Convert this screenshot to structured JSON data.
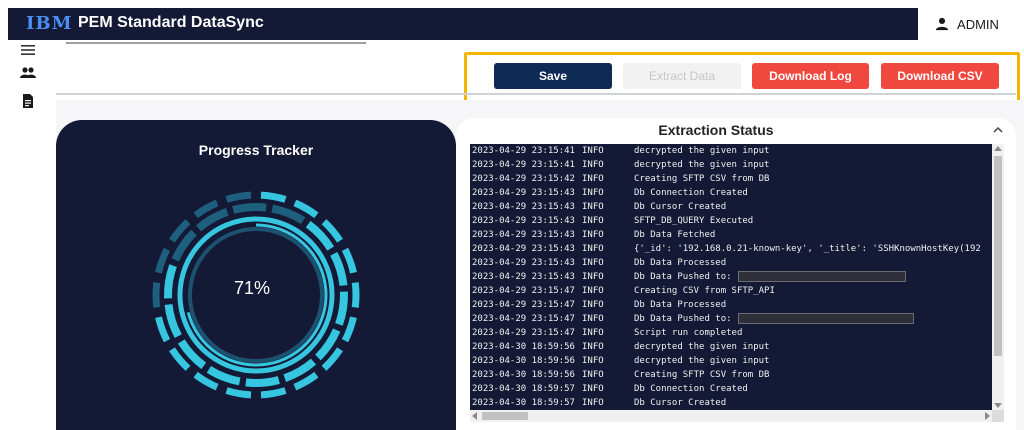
{
  "header": {
    "logo_text": "IBM",
    "title": "PEM Standard DataSync",
    "user_label": "ADMIN",
    "user_icon": "person-icon"
  },
  "sidebar": {
    "items": [
      {
        "icon": "menu-icon"
      },
      {
        "icon": "people-icon"
      },
      {
        "icon": "document-icon"
      }
    ]
  },
  "toolbar": {
    "save_label": "Save",
    "extract_label": "Extract Data",
    "extract_disabled": true,
    "download_log_label": "Download Log",
    "download_csv_label": "Download CSV"
  },
  "progress": {
    "title": "Progress Tracker",
    "value_text": "71%",
    "value": 71
  },
  "extraction": {
    "title": "Extraction Status",
    "logs": [
      {
        "ts": "2023-04-29 23:15:41",
        "level": "INFO",
        "msg": "decrypted the given input"
      },
      {
        "ts": "2023-04-29 23:15:41",
        "level": "INFO",
        "msg": "decrypted the given input"
      },
      {
        "ts": "2023-04-29 23:15:42",
        "level": "INFO",
        "msg": "Creating SFTP CSV from DB"
      },
      {
        "ts": "2023-04-29 23:15:43",
        "level": "INFO",
        "msg": "Db Connection Created"
      },
      {
        "ts": "2023-04-29 23:15:43",
        "level": "INFO",
        "msg": "Db Cursor Created"
      },
      {
        "ts": "2023-04-29 23:15:43",
        "level": "INFO",
        "msg": "SFTP_DB_QUERY Executed"
      },
      {
        "ts": "2023-04-29 23:15:43",
        "level": "INFO",
        "msg": "Db Data Fetched"
      },
      {
        "ts": "2023-04-29 23:15:43",
        "level": "INFO",
        "msg": "{'_id': '192.168.0.21-known-key', '_title': 'SSHKnownHostKey(192"
      },
      {
        "ts": "2023-04-29 23:15:43",
        "level": "INFO",
        "msg": "Db Data Processed"
      },
      {
        "ts": "2023-04-29 23:15:43",
        "level": "INFO",
        "msg": "Db Data Pushed to:",
        "redacted": true
      },
      {
        "ts": "2023-04-29 23:15:47",
        "level": "INFO",
        "msg": "Creating CSV from SFTP_API"
      },
      {
        "ts": "2023-04-29 23:15:47",
        "level": "INFO",
        "msg": "Db Data Processed"
      },
      {
        "ts": "2023-04-29 23:15:47",
        "level": "INFO",
        "msg": "Db Data Pushed to:",
        "redacted": true
      },
      {
        "ts": "2023-04-29 23:15:47",
        "level": "INFO",
        "msg": "Script run completed"
      },
      {
        "ts": "2023-04-30 18:59:56",
        "level": "INFO",
        "msg": "decrypted the given input"
      },
      {
        "ts": "2023-04-30 18:59:56",
        "level": "INFO",
        "msg": "decrypted the given input"
      },
      {
        "ts": "2023-04-30 18:59:56",
        "level": "INFO",
        "msg": "Creating SFTP CSV from DB"
      },
      {
        "ts": "2023-04-30 18:59:57",
        "level": "INFO",
        "msg": "Db Connection Created"
      },
      {
        "ts": "2023-04-30 18:59:57",
        "level": "INFO",
        "msg": "Db Cursor Created"
      }
    ]
  },
  "colors": {
    "navy": "#141935",
    "accent_red": "#f0483e",
    "save_blue": "#0e2a55",
    "highlight": "#f5b400",
    "ring_cyan": "#36c6e0",
    "ring_dark": "#1e5f7e"
  }
}
